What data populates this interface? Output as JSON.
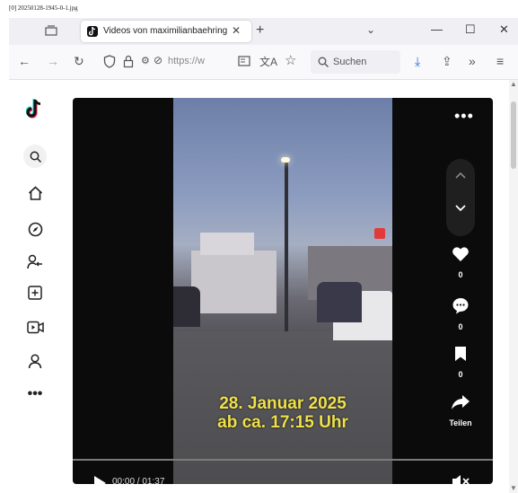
{
  "caption": "[0] 20250128-1945-0-1.jpg",
  "browser": {
    "tab_title": "Videos von maximilianbaehring",
    "url_text": "https://w",
    "search_placeholder": "Suchen"
  },
  "video": {
    "overlay_line1": "28. Januar 2025",
    "overlay_line2": "ab ca. 17:15 Uhr",
    "time": "00:00 / 01:37",
    "like_count": "0",
    "comment_count": "0",
    "save_count": "0",
    "share_label": "Teilen"
  },
  "sidebar_icons": [
    "tiktok-logo",
    "search-icon",
    "home-icon",
    "explore-icon",
    "following-icon",
    "upload-icon",
    "live-icon",
    "profile-icon",
    "more-icon"
  ]
}
